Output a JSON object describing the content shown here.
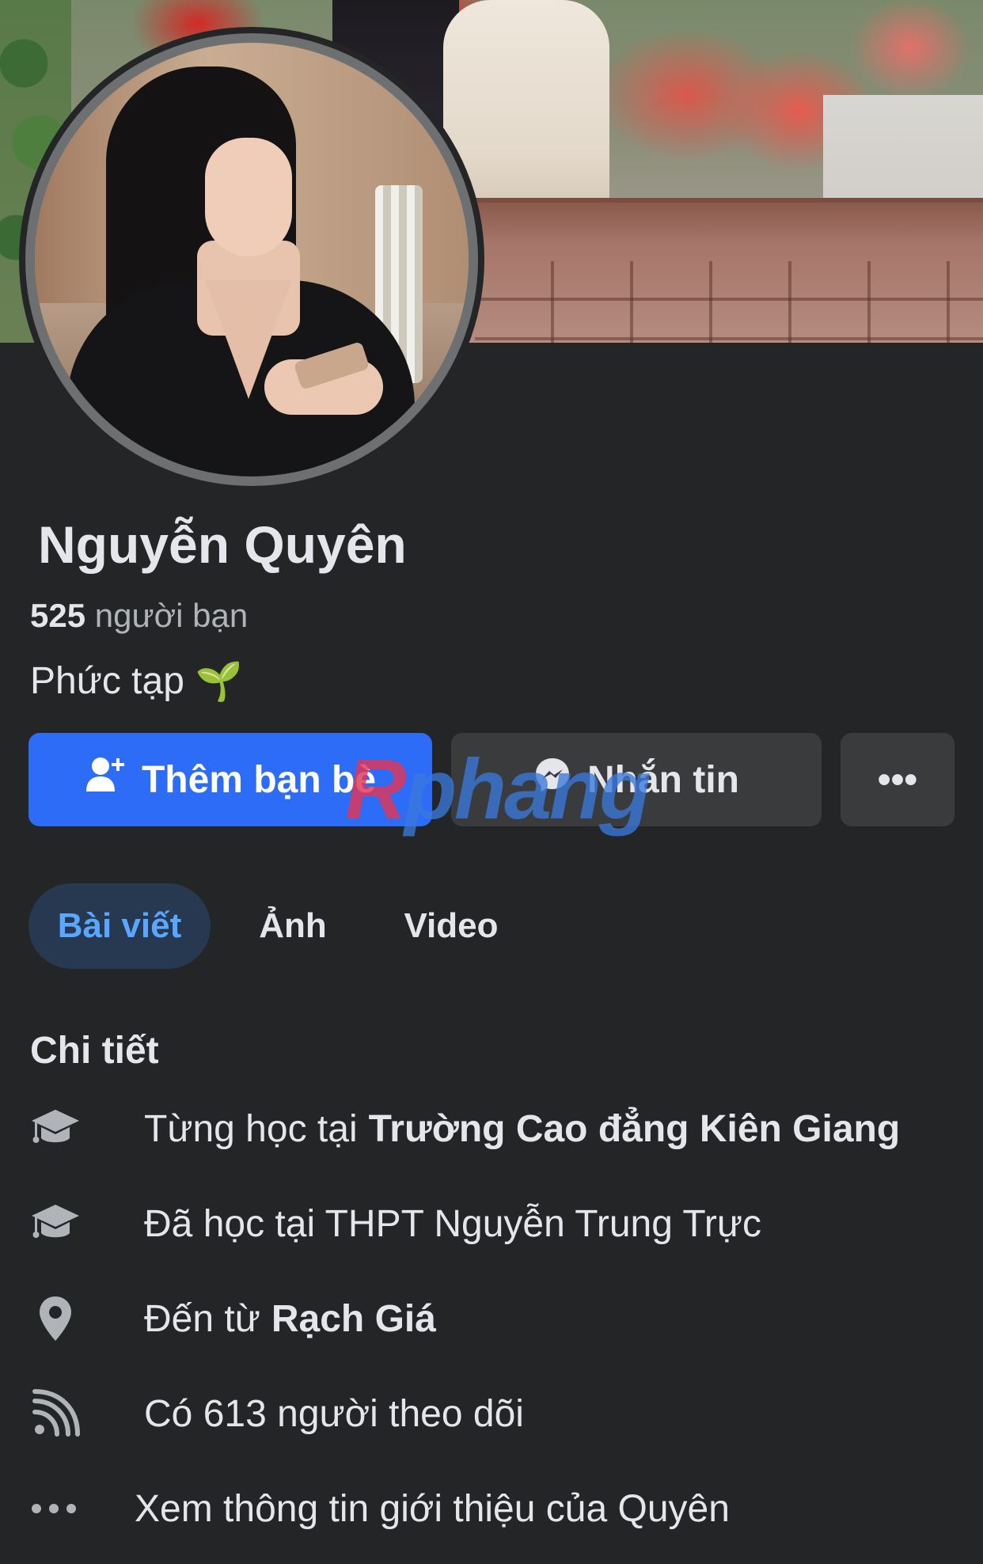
{
  "profile": {
    "name": "Nguyễn Quyên",
    "friends_count": "525",
    "friends_label": "người bạn",
    "bio": "Phức tạp",
    "bio_emoji": "🌱"
  },
  "actions": {
    "add_friend": "Thêm bạn bè",
    "message": "Nhắn tin",
    "more": "•••"
  },
  "watermark": {
    "text_a": "R",
    "text_b": "phang"
  },
  "tabs": [
    {
      "label": "Bài viết",
      "active": true
    },
    {
      "label": "Ảnh",
      "active": false
    },
    {
      "label": "Video",
      "active": false
    }
  ],
  "details": {
    "title": "Chi tiết",
    "items": [
      {
        "icon": "graduation-cap-icon",
        "prefix": "Từng học tại",
        "bold": "Trường Cao đẳng Kiên Giang"
      },
      {
        "icon": "graduation-cap-icon",
        "prefix": "Đã học tại THPT Nguyễn Trung Trực",
        "bold": ""
      },
      {
        "icon": "location-pin-icon",
        "prefix": "Đến từ",
        "bold": "Rạch Giá"
      },
      {
        "icon": "rss-feed-icon",
        "prefix": "Có 613 người theo dõi",
        "bold": ""
      },
      {
        "icon": "more-dots-icon",
        "prefix": "Xem thông tin giới thiệu của Quyên",
        "bold": ""
      }
    ]
  },
  "colors": {
    "background": "#242526",
    "primary_button": "#2d6cf6",
    "secondary_button": "#3a3b3c",
    "active_tab_bg": "#263951",
    "active_tab_text": "#5aa7ff"
  }
}
